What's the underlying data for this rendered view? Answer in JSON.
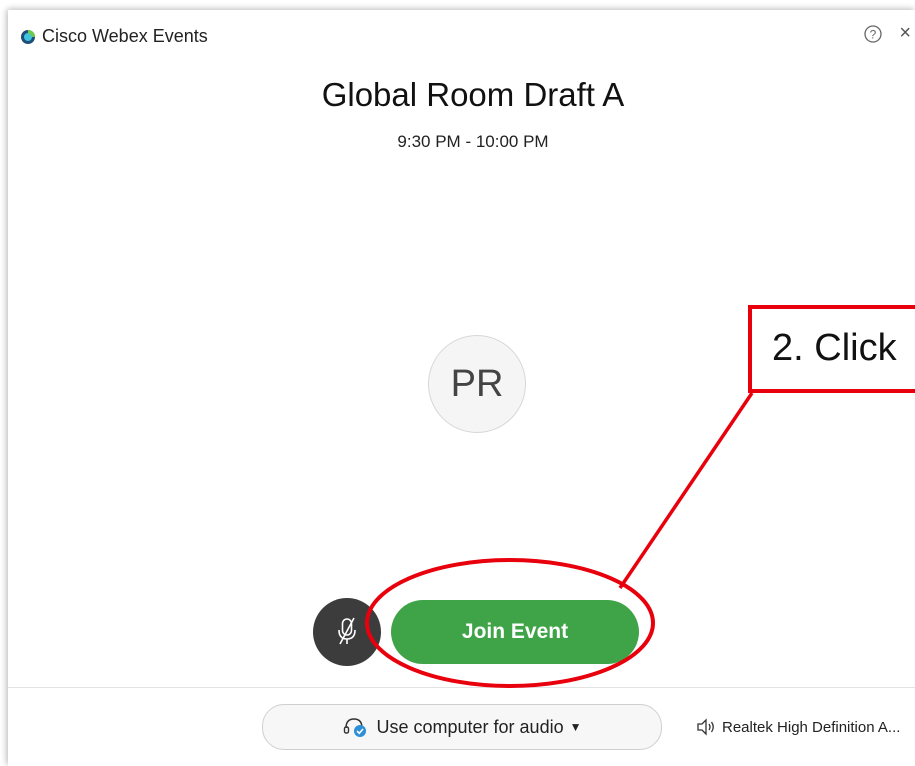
{
  "window": {
    "app_title": "Cisco Webex Events",
    "help_icon": "help-circle-icon",
    "close_label": "×"
  },
  "meeting": {
    "title": "Global Room Draft A",
    "time": "9:30 PM - 10:00 PM"
  },
  "avatar": {
    "initials": "PR"
  },
  "controls": {
    "mute_icon": "mic-off-icon",
    "join_label": "Join Event",
    "join_color": "#3fa447"
  },
  "footer": {
    "audio_label": "Use computer for audio",
    "speaker_label": "Realtek High Definition A..."
  },
  "annotation": {
    "callout_text": "2. Click",
    "color": "#e8000c"
  }
}
